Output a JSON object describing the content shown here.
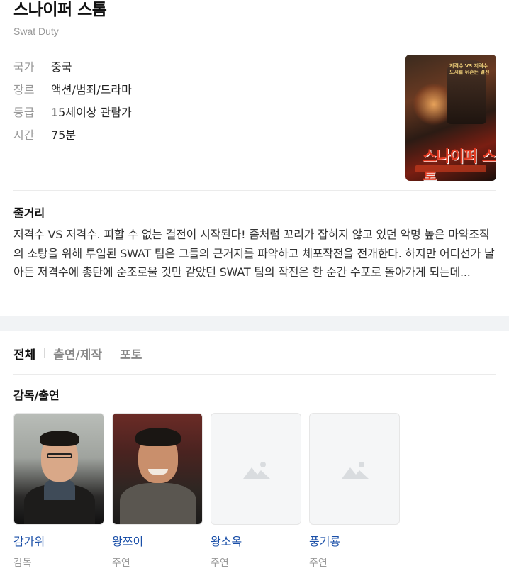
{
  "movie": {
    "title": "스나이퍼 스톰",
    "subtitle": "Swat Duty",
    "info": [
      {
        "label": "국가",
        "value": "중국"
      },
      {
        "label": "장르",
        "value": "액션/범죄/드라마"
      },
      {
        "label": "등급",
        "value": "15세이상 관람가"
      },
      {
        "label": "시간",
        "value": "75분"
      }
    ],
    "poster": {
      "top_text": "저격수 VS 저격수 도시를 뒤흔든 결전",
      "title_text": "스나이퍼 스톰"
    }
  },
  "synopsis": {
    "heading": "줄거리",
    "text": "저격수 VS 저격수. 피할 수 없는 결전이 시작된다! 좀처럼 꼬리가 잡히지 않고 있던 악명 높은 마약조직의 소탕을 위해 투입된 SWAT 팀은 그들의 근거지를 파악하고 체포작전을 전개한다. 하지만 어디선가 날아든 저격수에 총탄에 순조로울 것만 같았던 SWAT 팀의 작전은 한 순간 수포로 돌아가게 되는데..."
  },
  "tabs": [
    {
      "label": "전체",
      "active": true
    },
    {
      "label": "출연/제작",
      "active": false
    },
    {
      "label": "포토",
      "active": false
    }
  ],
  "cast_section": {
    "heading": "감독/출연",
    "people": [
      {
        "name": "감가위",
        "role": "감독",
        "has_photo": true
      },
      {
        "name": "왕쯔이",
        "role": "주연",
        "has_photo": true
      },
      {
        "name": "왕소옥",
        "role": "주연",
        "has_photo": false
      },
      {
        "name": "풍기룡",
        "role": "주연",
        "has_photo": false
      }
    ]
  },
  "colors": {
    "link": "#1a4fa8",
    "muted": "#999999",
    "background": "#f1f3f5"
  }
}
